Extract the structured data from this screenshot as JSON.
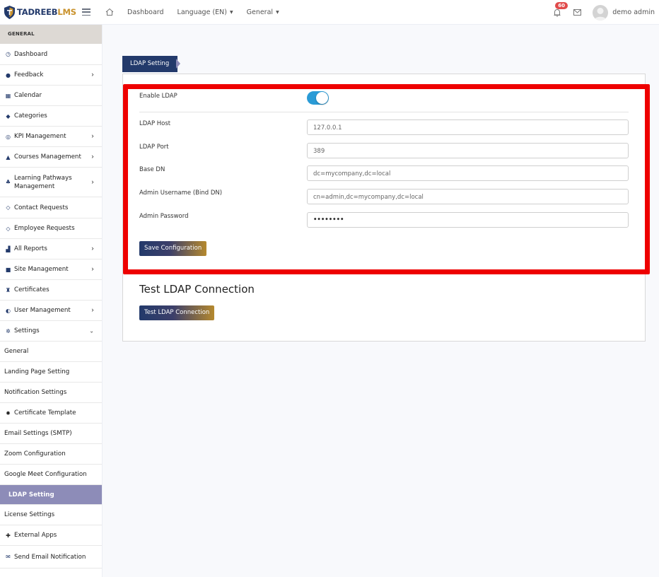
{
  "header": {
    "logo_part1": "TADREEB",
    "logo_part2": "LMS",
    "nav": [
      {
        "label": "Dashboard"
      },
      {
        "label": "Language (EN)"
      },
      {
        "label": "General"
      }
    ],
    "notification_count": "60",
    "user_name": "demo admin"
  },
  "sidebar": {
    "section_label": "GENERAL",
    "items": [
      {
        "label": "Dashboard",
        "icon": "gauge-icon"
      },
      {
        "label": "Feedback",
        "icon": "comments-icon"
      },
      {
        "label": "Calendar",
        "icon": "calendar-icon"
      },
      {
        "label": "Categories",
        "icon": "tags-icon"
      },
      {
        "label": "KPI Management",
        "icon": "target-icon"
      },
      {
        "label": "Courses Management",
        "icon": "graduation-cap-icon"
      },
      {
        "label": "Learning Pathways",
        "label2": "Management",
        "icon": "sitemap-icon"
      },
      {
        "label": "Contact Requests",
        "icon": "tag-icon"
      },
      {
        "label": "Employee Requests",
        "icon": "tag-icon"
      },
      {
        "label": "All Reports",
        "icon": "chart-icon"
      },
      {
        "label": "Site Management",
        "icon": "folder-icon"
      },
      {
        "label": "Certificates",
        "icon": "trophy-icon"
      },
      {
        "label": "User Management",
        "icon": "shield-icon"
      },
      {
        "label": "Settings",
        "icon": "gear-icon"
      },
      {
        "label": "General"
      },
      {
        "label": "Landing Page Setting"
      },
      {
        "label": "Notification Settings"
      },
      {
        "label": "Certificate Template",
        "icon": "certificate-icon"
      },
      {
        "label": "Email Settings (SMTP)"
      },
      {
        "label": "Zoom Configuration"
      },
      {
        "label": "Google Meet Configuration"
      },
      {
        "label": "LDAP Setting"
      },
      {
        "label": "License Settings"
      },
      {
        "label": "External Apps",
        "icon": "puzzle-icon"
      },
      {
        "label": "Send Email Notification",
        "icon": "envelope-icon"
      }
    ]
  },
  "main": {
    "tab_label": "LDAP Setting",
    "form": {
      "enable_label": "Enable LDAP",
      "enable_value": true,
      "host_label": "LDAP Host",
      "host_value": "127.0.0.1",
      "port_label": "LDAP Port",
      "port_value": "389",
      "base_dn_label": "Base DN",
      "base_dn_value": "dc=mycompany,dc=local",
      "bind_label": "Admin Username (Bind DN)",
      "bind_value": "cn=admin,dc=mycompany,dc=local",
      "password_label": "Admin Password",
      "password_value": "••••••••",
      "save_button": "Save Configuration"
    },
    "test_title": "Test LDAP Connection",
    "test_button": "Test LDAP Connection"
  },
  "colors": {
    "brand_navy": "#233a6b",
    "brand_gold": "#c9922c",
    "active_item": "#8d8cb8",
    "toggle_on": "#2a9bd6",
    "highlight": "#ee0000",
    "badge": "#e14b4b"
  }
}
